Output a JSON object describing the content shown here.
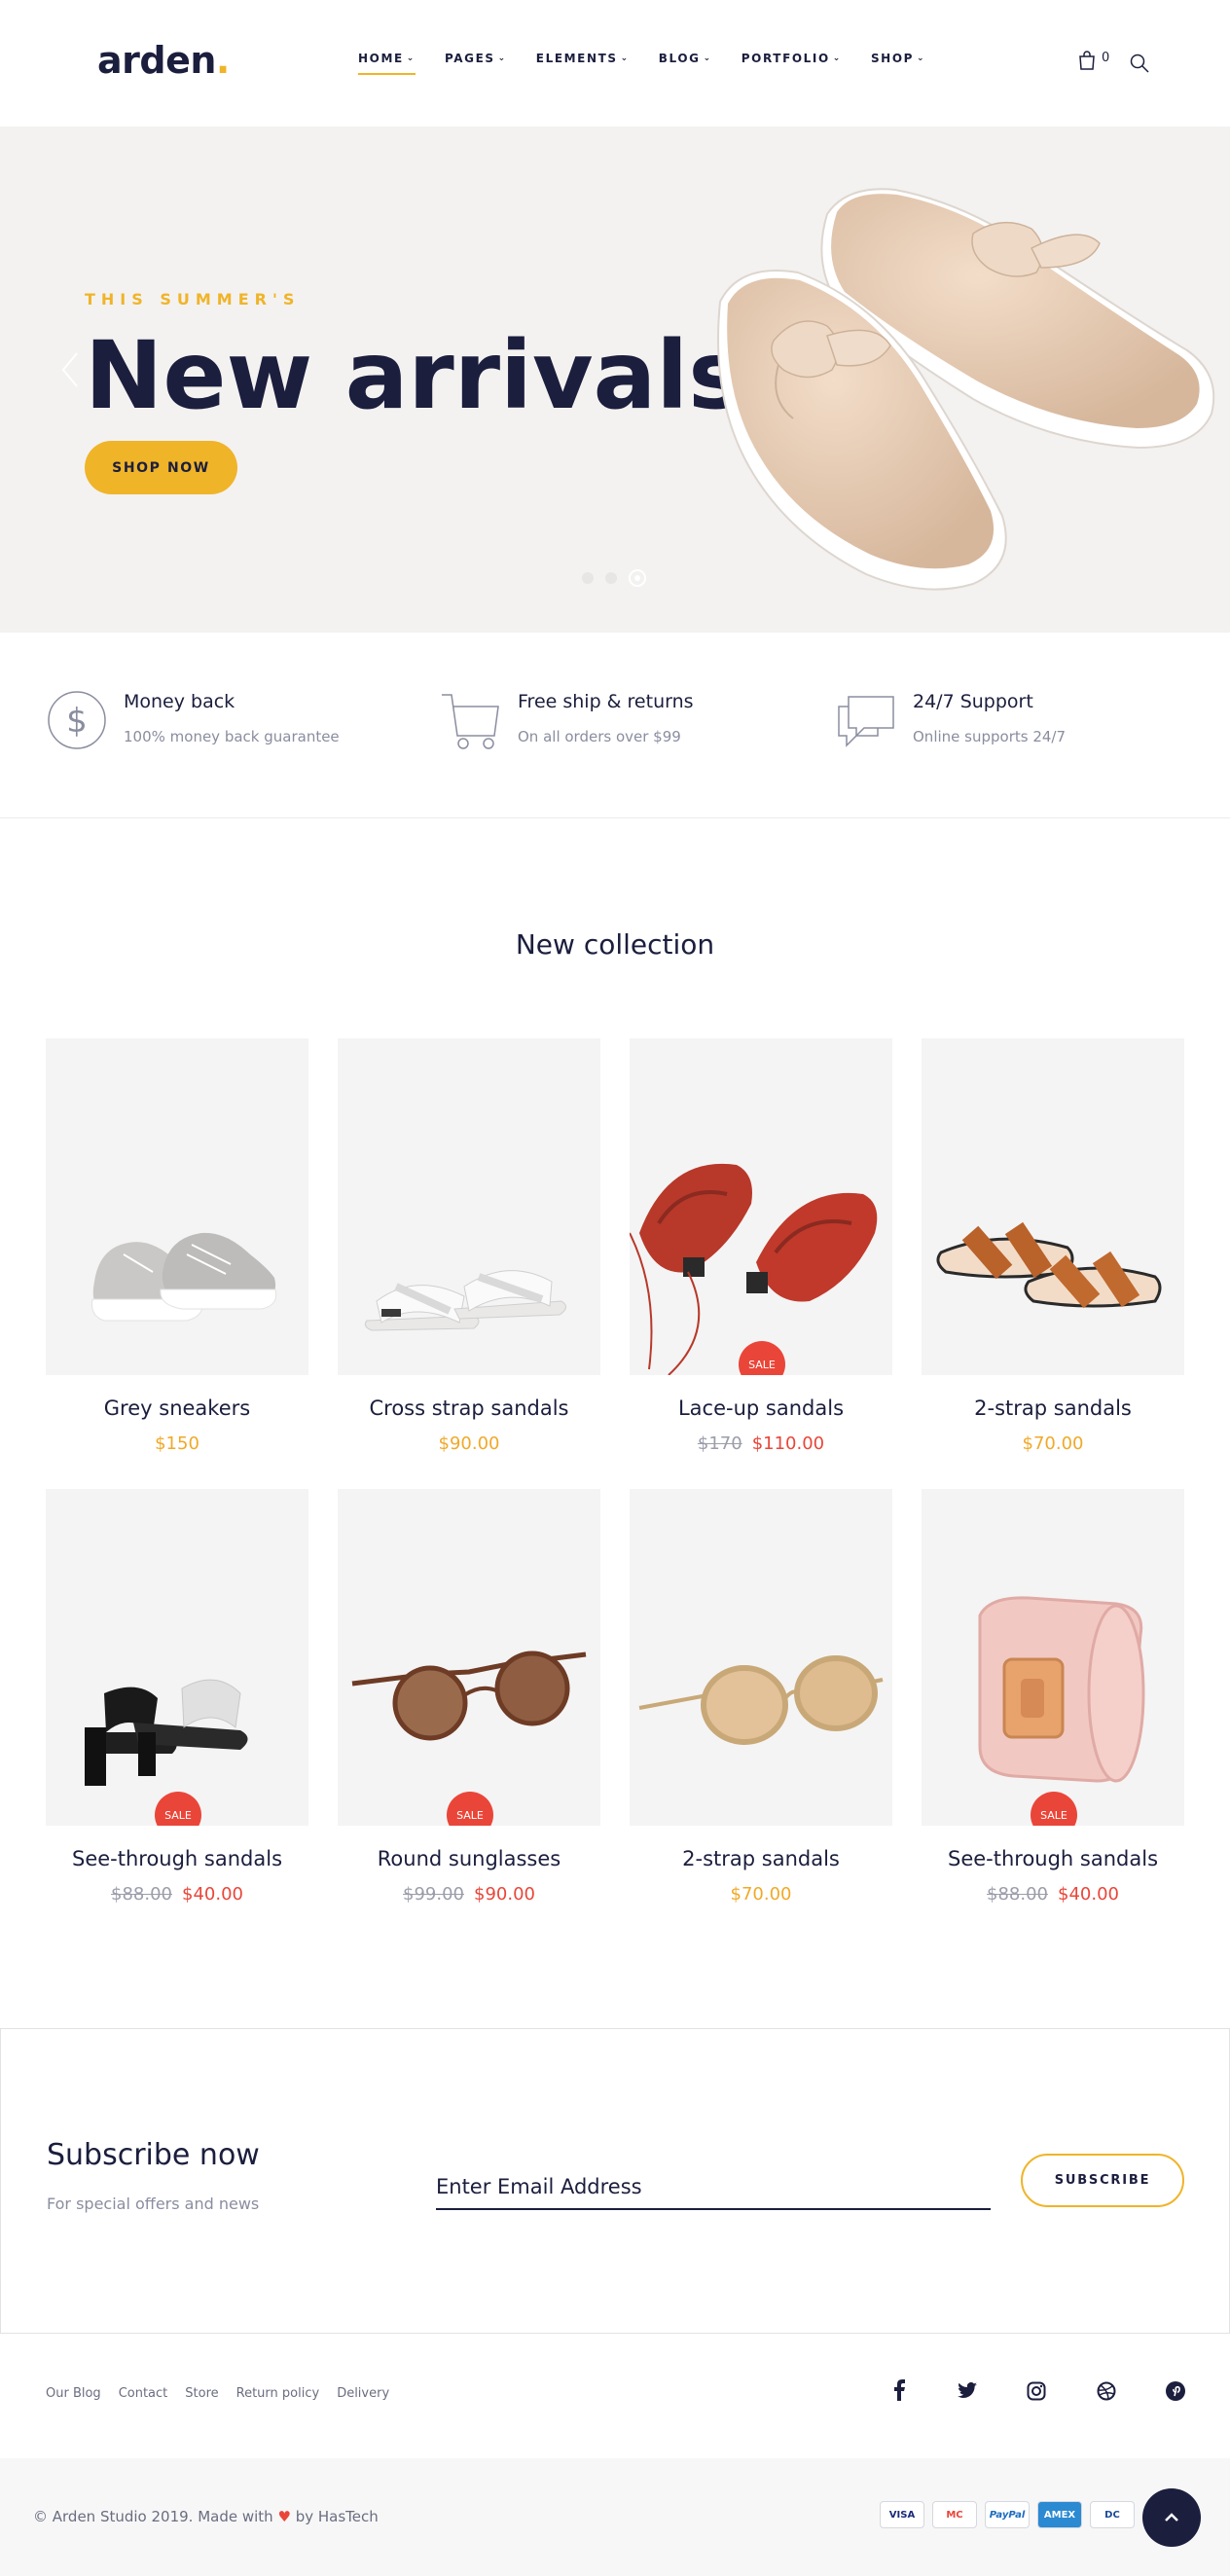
{
  "header": {
    "logo_text": "arden",
    "logo_dot": ".",
    "nav": [
      {
        "label": "HOME",
        "active": true
      },
      {
        "label": "PAGES"
      },
      {
        "label": "ELEMENTS"
      },
      {
        "label": "BLOG"
      },
      {
        "label": "PORTFOLIO"
      },
      {
        "label": "SHOP"
      }
    ],
    "cart_count": "0"
  },
  "hero": {
    "kicker": "THIS SUMMER'S",
    "title": "New arrivals",
    "cta": "SHOP NOW"
  },
  "features": [
    {
      "title": "Money back",
      "subtitle": "100% money back guarantee",
      "icon": "dollar-icon"
    },
    {
      "title": "Free ship & returns",
      "subtitle": "On all orders over $99",
      "icon": "cart-icon"
    },
    {
      "title": "24/7 Support",
      "subtitle": "Online supports 24/7",
      "icon": "chat-icon"
    }
  ],
  "collection": {
    "title": "New collection",
    "sale_label": "SALE",
    "products": [
      {
        "name": "Grey sneakers",
        "price": "$150",
        "old_price": "",
        "sale": false
      },
      {
        "name": "Cross strap sandals",
        "price": "$90.00",
        "old_price": "",
        "sale": false
      },
      {
        "name": "Lace-up sandals",
        "price": "$110.00",
        "old_price": "$170",
        "sale": true
      },
      {
        "name": "2-strap sandals",
        "price": "$70.00",
        "old_price": "",
        "sale": false
      },
      {
        "name": "See-through sandals",
        "price": "$40.00",
        "old_price": "$88.00",
        "sale": true
      },
      {
        "name": "Round sunglasses",
        "price": "$90.00",
        "old_price": "$99.00",
        "sale": true
      },
      {
        "name": "2-strap sandals",
        "price": "$70.00",
        "old_price": "",
        "sale": false
      },
      {
        "name": "See-through sandals",
        "price": "$40.00",
        "old_price": "$88.00",
        "sale": true
      }
    ]
  },
  "subscribe": {
    "title": "Subscribe now",
    "subtitle": "For special offers and news",
    "placeholder": "Enter Email Address",
    "button": "SUBSCRIBE"
  },
  "footer": {
    "links": [
      "Our Blog",
      "Contact",
      "Store",
      "Return policy",
      "Delivery"
    ],
    "social": [
      "facebook-icon",
      "twitter-icon",
      "instagram-icon",
      "dribbble-icon",
      "pinterest-icon"
    ],
    "copyright_pre": "© Arden Studio 2019. Made with",
    "heart": "♥",
    "copyright_post": "by HasTech",
    "payments": [
      "VISA",
      "MC",
      "PayPal",
      "AMEX",
      "DC"
    ]
  },
  "colors": {
    "accent": "#f0b429",
    "sale": "#e94639",
    "navy": "#1b1e3d"
  }
}
